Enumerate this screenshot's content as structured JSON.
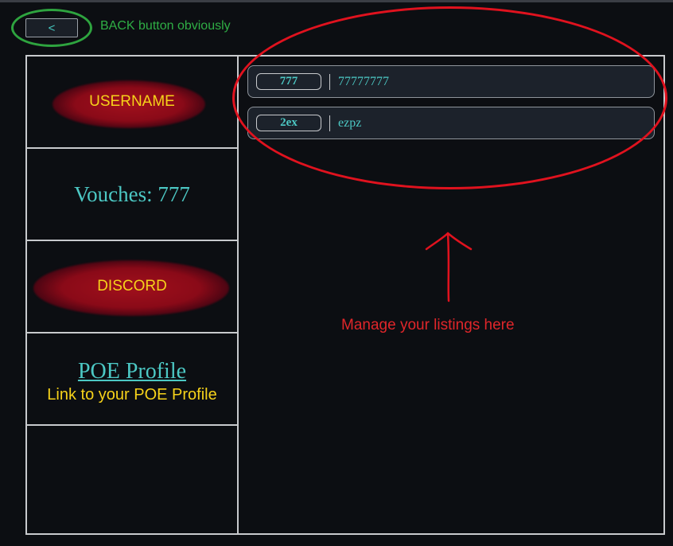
{
  "back_button": {
    "label": "<"
  },
  "annotations": {
    "back_note": "BACK button obviously",
    "manage_note": "Manage your listings here"
  },
  "profile": {
    "username": "USERNAME",
    "vouches": "Vouches: 777",
    "discord": "DISCORD",
    "poe_link": "POE Profile",
    "poe_note": "Link to your POE Profile"
  },
  "listings": [
    {
      "price": "777",
      "name": "77777777"
    },
    {
      "price": "2ex",
      "name": "ezpz"
    }
  ],
  "colors": {
    "background": "#0c0e12",
    "accent_teal": "#4cc8c4",
    "annotation_red": "#e0121e",
    "annotation_green": "#2ea43f",
    "label_yellow": "#f6d21a",
    "redaction": "#8a0a18"
  }
}
